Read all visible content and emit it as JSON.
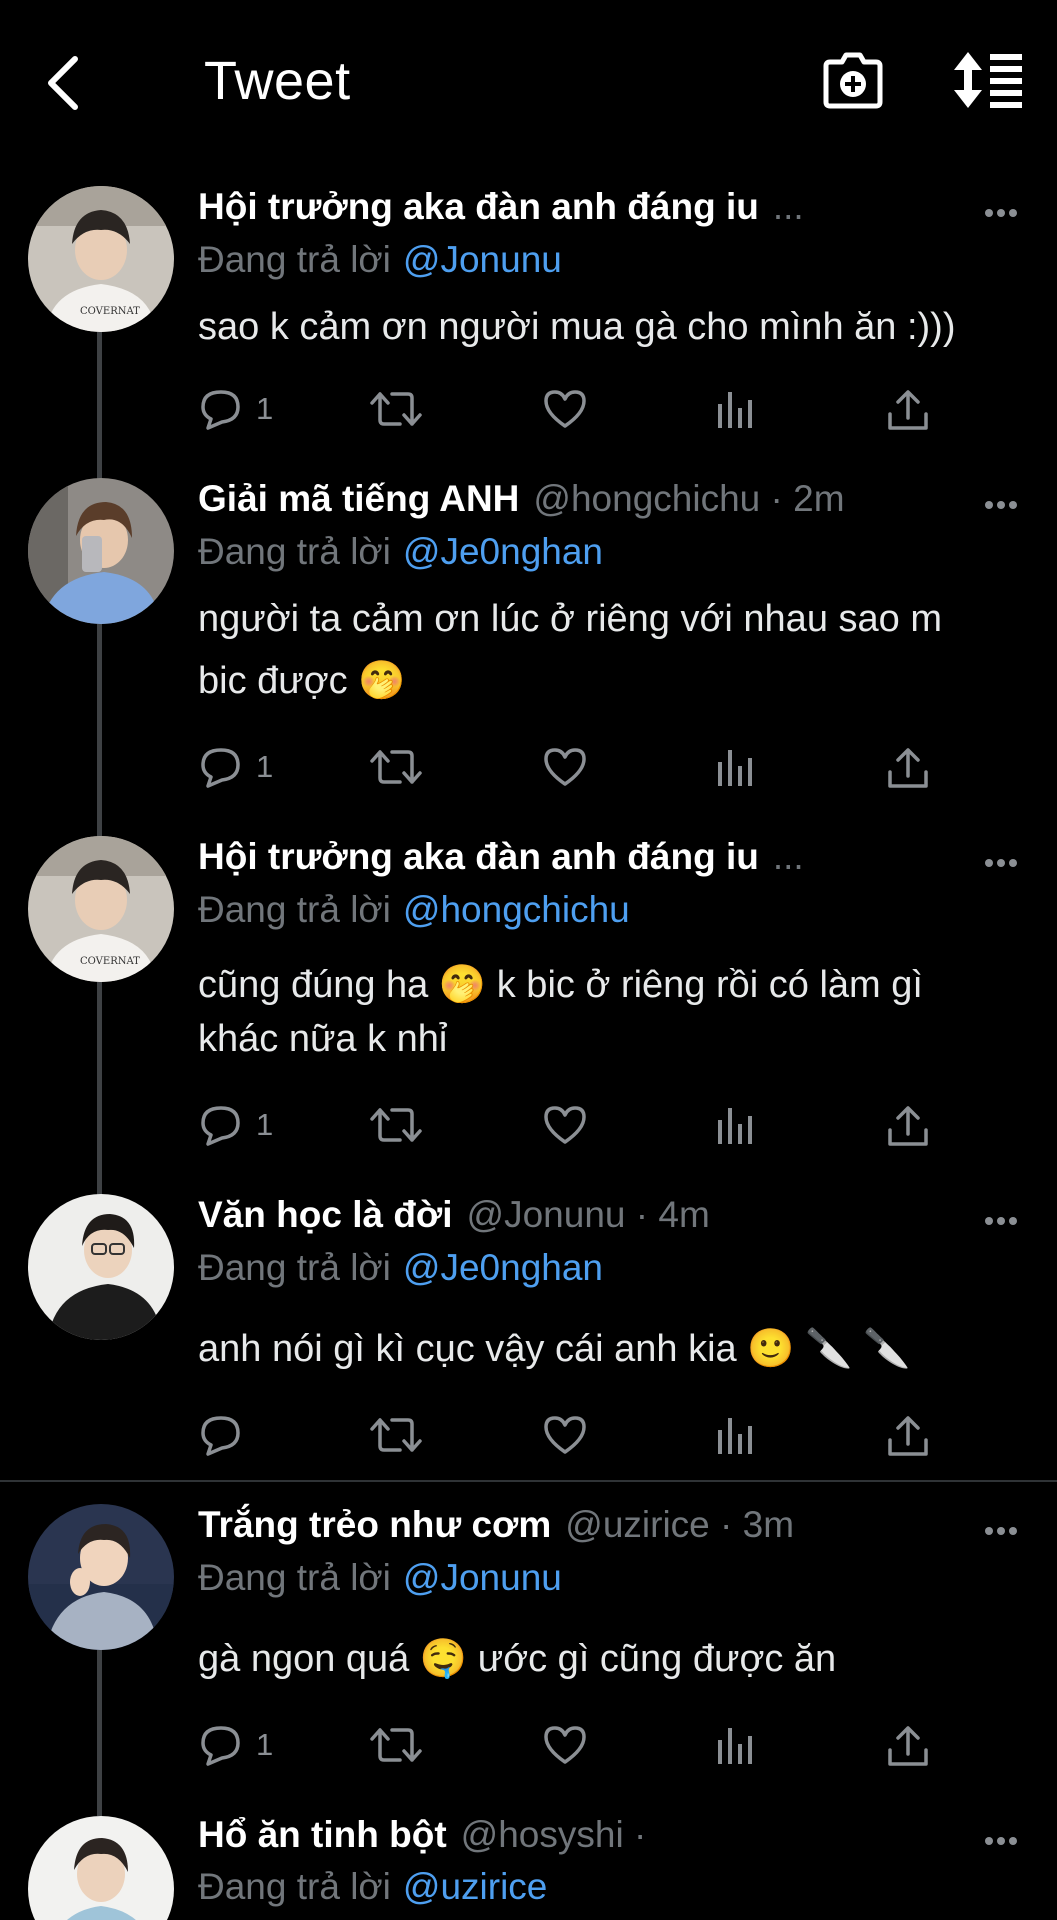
{
  "header": {
    "title": "Tweet",
    "back_icon": "chevron-left-icon",
    "camera_icon": "camera-plus-icon",
    "sort_icon": "sort-list-icon"
  },
  "colors": {
    "background": "#000000",
    "text": "#e7e9ea",
    "muted": "#71767b",
    "mention": "#4e9ff0",
    "thread_line": "#3e4144"
  },
  "reply_prefix": "Đang trả lời",
  "tweets": [
    {
      "name": "Hội trưởng aka đàn anh đáng iu",
      "handle_time": "...",
      "reply_to": "@Jonunu",
      "text": "sao k cảm ơn người mua gà cho mình ăn :)))",
      "reply_count": "1"
    },
    {
      "name": "Giải mã tiếng ANH",
      "handle_time": "@hongchichu · 2m",
      "reply_to": "@Je0nghan",
      "text": "người ta cảm ơn lúc ở riêng với nhau sao m bic được 🤭",
      "reply_count": "1"
    },
    {
      "name": "Hội trưởng aka đàn anh đáng iu",
      "handle_time": "...",
      "reply_to": "@hongchichu",
      "text": "cũng đúng ha 🤭 k bic ở riêng rồi có làm gì khác nữa k nhỉ",
      "reply_count": "1"
    },
    {
      "name": "Văn học là đời",
      "handle_time": "@Jonunu · 4m",
      "reply_to": "@Je0nghan",
      "text": "anh nói gì kì cục vậy cái anh kia 🙂 🔪 🔪",
      "reply_count": ""
    },
    {
      "name": "Trắng trẻo như cơm",
      "handle_time": "@uzirice · 3m",
      "reply_to": "@Jonunu",
      "text": "gà ngon quá 🤤  ước gì cũng được ăn",
      "reply_count": "1"
    },
    {
      "name": "Hổ ăn tinh bột",
      "handle_time": "@hosyshi ·",
      "reply_to": "@uzirice",
      "text": "",
      "reply_count": ""
    }
  ]
}
